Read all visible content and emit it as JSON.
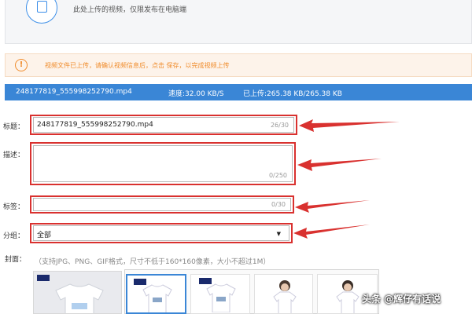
{
  "upload_panel": {
    "hint": "此处上传的视频，仅限发布在电脑端",
    "icon": "document-icon"
  },
  "notice": {
    "icon": "warning-icon",
    "text": "视频文件已上传，请确认视频信息后，点击 保存，以完成视频上传"
  },
  "progress": {
    "filename": "248177819_555998252790.mp4",
    "speed": "速度:32.00 KB/S",
    "uploaded": "已上传:265.38 KB/265.38 KB"
  },
  "form": {
    "title_label": "标题：",
    "title_value": "248177819_555998252790.mp4",
    "title_count": "26/30",
    "desc_label": "描述：",
    "desc_count": "0/250",
    "tag_label": "标签：",
    "tag_count": "0/30",
    "group_label": "分组：",
    "group_value": "全部",
    "cover_label": "封面：",
    "cover_hint": "（支持JPG、PNG、GIF格式，尺寸不低于160*160像素，大小不超过1M）"
  },
  "watermark": "头条 @辉仔有话说",
  "colors": {
    "accent_blue": "#3a86d6",
    "highlight_red": "#d9312f",
    "warning_orange": "#f08c2c"
  }
}
